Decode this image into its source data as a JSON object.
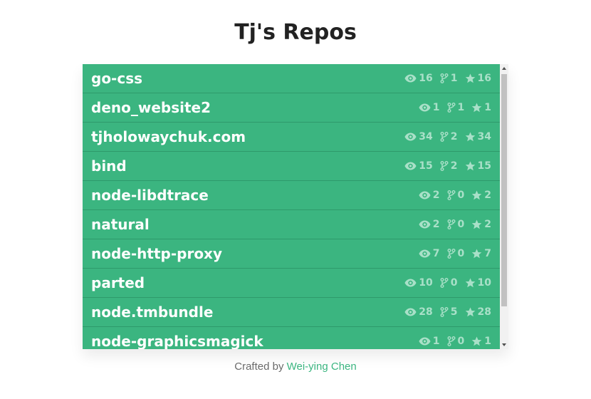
{
  "header": {
    "title": "Tj's Repos"
  },
  "repos": [
    {
      "name": "go-css",
      "watchers": "16",
      "forks": "1",
      "stars": "16"
    },
    {
      "name": "deno_website2",
      "watchers": "1",
      "forks": "1",
      "stars": "1"
    },
    {
      "name": "tjholowaychuk.com",
      "watchers": "34",
      "forks": "2",
      "stars": "34"
    },
    {
      "name": "bind",
      "watchers": "15",
      "forks": "2",
      "stars": "15"
    },
    {
      "name": "node-libdtrace",
      "watchers": "2",
      "forks": "0",
      "stars": "2"
    },
    {
      "name": "natural",
      "watchers": "2",
      "forks": "0",
      "stars": "2"
    },
    {
      "name": "node-http-proxy",
      "watchers": "7",
      "forks": "0",
      "stars": "7"
    },
    {
      "name": "parted",
      "watchers": "10",
      "forks": "0",
      "stars": "10"
    },
    {
      "name": "node.tmbundle",
      "watchers": "28",
      "forks": "5",
      "stars": "28"
    },
    {
      "name": "node-graphicsmagick",
      "watchers": "1",
      "forks": "0",
      "stars": "1"
    }
  ],
  "icons": {
    "watchers": "eye-icon",
    "forks": "fork-icon",
    "stars": "star-icon"
  },
  "colors": {
    "row_bg": "#3bb580",
    "row_border": "#2e9a6b",
    "stat_text": "#a9e0c8",
    "link": "#3bb580"
  },
  "footer": {
    "prefix": "Crafted by",
    "author": "Wei-ying Chen"
  }
}
